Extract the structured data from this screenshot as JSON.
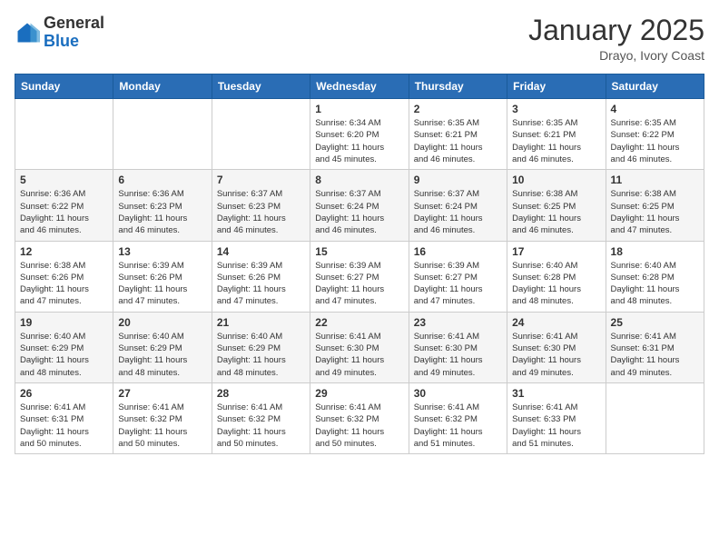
{
  "header": {
    "logo_general": "General",
    "logo_blue": "Blue",
    "month": "January 2025",
    "location": "Drayo, Ivory Coast"
  },
  "days_of_week": [
    "Sunday",
    "Monday",
    "Tuesday",
    "Wednesday",
    "Thursday",
    "Friday",
    "Saturday"
  ],
  "weeks": [
    [
      {
        "day": "",
        "info": ""
      },
      {
        "day": "",
        "info": ""
      },
      {
        "day": "",
        "info": ""
      },
      {
        "day": "1",
        "info": "Sunrise: 6:34 AM\nSunset: 6:20 PM\nDaylight: 11 hours\nand 45 minutes."
      },
      {
        "day": "2",
        "info": "Sunrise: 6:35 AM\nSunset: 6:21 PM\nDaylight: 11 hours\nand 46 minutes."
      },
      {
        "day": "3",
        "info": "Sunrise: 6:35 AM\nSunset: 6:21 PM\nDaylight: 11 hours\nand 46 minutes."
      },
      {
        "day": "4",
        "info": "Sunrise: 6:35 AM\nSunset: 6:22 PM\nDaylight: 11 hours\nand 46 minutes."
      }
    ],
    [
      {
        "day": "5",
        "info": "Sunrise: 6:36 AM\nSunset: 6:22 PM\nDaylight: 11 hours\nand 46 minutes."
      },
      {
        "day": "6",
        "info": "Sunrise: 6:36 AM\nSunset: 6:23 PM\nDaylight: 11 hours\nand 46 minutes."
      },
      {
        "day": "7",
        "info": "Sunrise: 6:37 AM\nSunset: 6:23 PM\nDaylight: 11 hours\nand 46 minutes."
      },
      {
        "day": "8",
        "info": "Sunrise: 6:37 AM\nSunset: 6:24 PM\nDaylight: 11 hours\nand 46 minutes."
      },
      {
        "day": "9",
        "info": "Sunrise: 6:37 AM\nSunset: 6:24 PM\nDaylight: 11 hours\nand 46 minutes."
      },
      {
        "day": "10",
        "info": "Sunrise: 6:38 AM\nSunset: 6:25 PM\nDaylight: 11 hours\nand 46 minutes."
      },
      {
        "day": "11",
        "info": "Sunrise: 6:38 AM\nSunset: 6:25 PM\nDaylight: 11 hours\nand 47 minutes."
      }
    ],
    [
      {
        "day": "12",
        "info": "Sunrise: 6:38 AM\nSunset: 6:26 PM\nDaylight: 11 hours\nand 47 minutes."
      },
      {
        "day": "13",
        "info": "Sunrise: 6:39 AM\nSunset: 6:26 PM\nDaylight: 11 hours\nand 47 minutes."
      },
      {
        "day": "14",
        "info": "Sunrise: 6:39 AM\nSunset: 6:26 PM\nDaylight: 11 hours\nand 47 minutes."
      },
      {
        "day": "15",
        "info": "Sunrise: 6:39 AM\nSunset: 6:27 PM\nDaylight: 11 hours\nand 47 minutes."
      },
      {
        "day": "16",
        "info": "Sunrise: 6:39 AM\nSunset: 6:27 PM\nDaylight: 11 hours\nand 47 minutes."
      },
      {
        "day": "17",
        "info": "Sunrise: 6:40 AM\nSunset: 6:28 PM\nDaylight: 11 hours\nand 48 minutes."
      },
      {
        "day": "18",
        "info": "Sunrise: 6:40 AM\nSunset: 6:28 PM\nDaylight: 11 hours\nand 48 minutes."
      }
    ],
    [
      {
        "day": "19",
        "info": "Sunrise: 6:40 AM\nSunset: 6:29 PM\nDaylight: 11 hours\nand 48 minutes."
      },
      {
        "day": "20",
        "info": "Sunrise: 6:40 AM\nSunset: 6:29 PM\nDaylight: 11 hours\nand 48 minutes."
      },
      {
        "day": "21",
        "info": "Sunrise: 6:40 AM\nSunset: 6:29 PM\nDaylight: 11 hours\nand 48 minutes."
      },
      {
        "day": "22",
        "info": "Sunrise: 6:41 AM\nSunset: 6:30 PM\nDaylight: 11 hours\nand 49 minutes."
      },
      {
        "day": "23",
        "info": "Sunrise: 6:41 AM\nSunset: 6:30 PM\nDaylight: 11 hours\nand 49 minutes."
      },
      {
        "day": "24",
        "info": "Sunrise: 6:41 AM\nSunset: 6:30 PM\nDaylight: 11 hours\nand 49 minutes."
      },
      {
        "day": "25",
        "info": "Sunrise: 6:41 AM\nSunset: 6:31 PM\nDaylight: 11 hours\nand 49 minutes."
      }
    ],
    [
      {
        "day": "26",
        "info": "Sunrise: 6:41 AM\nSunset: 6:31 PM\nDaylight: 11 hours\nand 50 minutes."
      },
      {
        "day": "27",
        "info": "Sunrise: 6:41 AM\nSunset: 6:32 PM\nDaylight: 11 hours\nand 50 minutes."
      },
      {
        "day": "28",
        "info": "Sunrise: 6:41 AM\nSunset: 6:32 PM\nDaylight: 11 hours\nand 50 minutes."
      },
      {
        "day": "29",
        "info": "Sunrise: 6:41 AM\nSunset: 6:32 PM\nDaylight: 11 hours\nand 50 minutes."
      },
      {
        "day": "30",
        "info": "Sunrise: 6:41 AM\nSunset: 6:32 PM\nDaylight: 11 hours\nand 51 minutes."
      },
      {
        "day": "31",
        "info": "Sunrise: 6:41 AM\nSunset: 6:33 PM\nDaylight: 11 hours\nand 51 minutes."
      },
      {
        "day": "",
        "info": ""
      }
    ]
  ]
}
